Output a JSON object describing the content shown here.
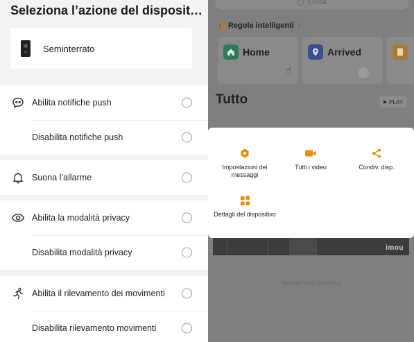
{
  "left_panel": {
    "title": "Seleziona l’azione del disposit…",
    "device": {
      "name": "Seminterrato"
    },
    "groups": [
      {
        "items": [
          {
            "label": "Abilita notifiche push",
            "icon": "chat-bubble-icon"
          },
          {
            "label": "Disabilita notifiche push",
            "icon": ""
          }
        ]
      },
      {
        "items": [
          {
            "label": "Suona l’allarme",
            "icon": "bell-icon"
          }
        ]
      },
      {
        "items": [
          {
            "label": "Abilita la modalità privacy",
            "icon": "eye-icon"
          },
          {
            "label": "Disabilita modalità privacy",
            "icon": ""
          }
        ]
      },
      {
        "items": [
          {
            "label": "Abilita il rilevamento dei movimenti",
            "icon": "running-person-icon"
          },
          {
            "label": "Disabilita rilevamento movimenti",
            "icon": ""
          }
        ]
      }
    ]
  },
  "right_panel": {
    "search": {
      "placeholder": "Cerca"
    },
    "smart_rules": {
      "title": "Regole intelligenti"
    },
    "scenes": [
      {
        "label": "Home",
        "icon": "home-icon",
        "color": "#2e9a6e"
      },
      {
        "label": "Arrived",
        "icon": "location-pin-icon",
        "color": "#3b5fd0"
      },
      {
        "label": "",
        "icon": "document-icon",
        "color": "#e8a030"
      }
    ],
    "all_title": "Tutto",
    "play_label": "PLAY",
    "camera_watermark": "imou",
    "no_more_data": "Nessun dato ulteriore",
    "popup_actions": [
      {
        "label": "Impostazioni dei messaggi",
        "icon": "gear-icon"
      },
      {
        "label": "Tutti i video",
        "icon": "video-camera-icon"
      },
      {
        "label": "Condiv. disp.",
        "icon": "share-icon"
      },
      {
        "label": "Dettagli del dispositivo",
        "icon": "grid-icon"
      }
    ]
  },
  "colors": {
    "accent": "#f08a00",
    "overlay": "#7f7f7f"
  }
}
